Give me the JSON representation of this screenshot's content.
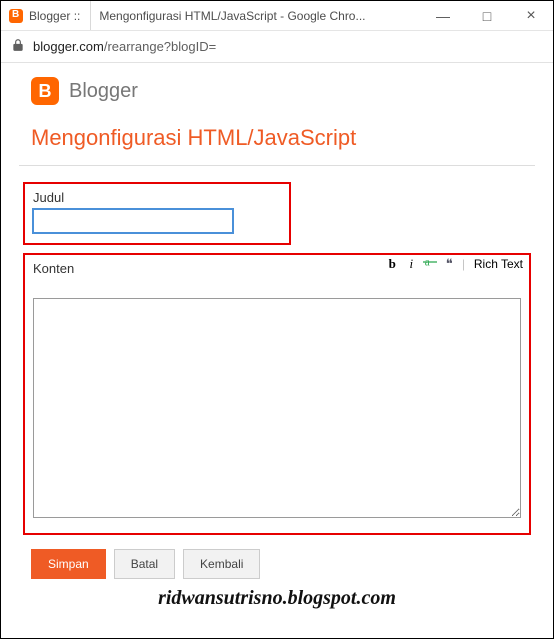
{
  "window": {
    "tab_label": "Blogger ::",
    "title": "Mengonfigurasi HTML/JavaScript - Google Chro...",
    "min": "—",
    "max": "□",
    "close": "×"
  },
  "address": {
    "host": "blogger.com",
    "path": "/rearrange?blogID="
  },
  "header": {
    "logo_letter": "B",
    "brand": "Blogger"
  },
  "page": {
    "title": "Mengonfigurasi HTML/JavaScript"
  },
  "form": {
    "judul_label": "Judul",
    "judul_value": "",
    "konten_label": "Konten",
    "konten_value": "",
    "toolbar": {
      "bold": "b",
      "italic": "i",
      "strike_icon": "strike",
      "quote": "❝",
      "richtext": "Rich Text"
    }
  },
  "buttons": {
    "save": "Simpan",
    "cancel": "Batal",
    "back": "Kembali"
  },
  "watermark": "ridwansutrisno.blogspot.com"
}
